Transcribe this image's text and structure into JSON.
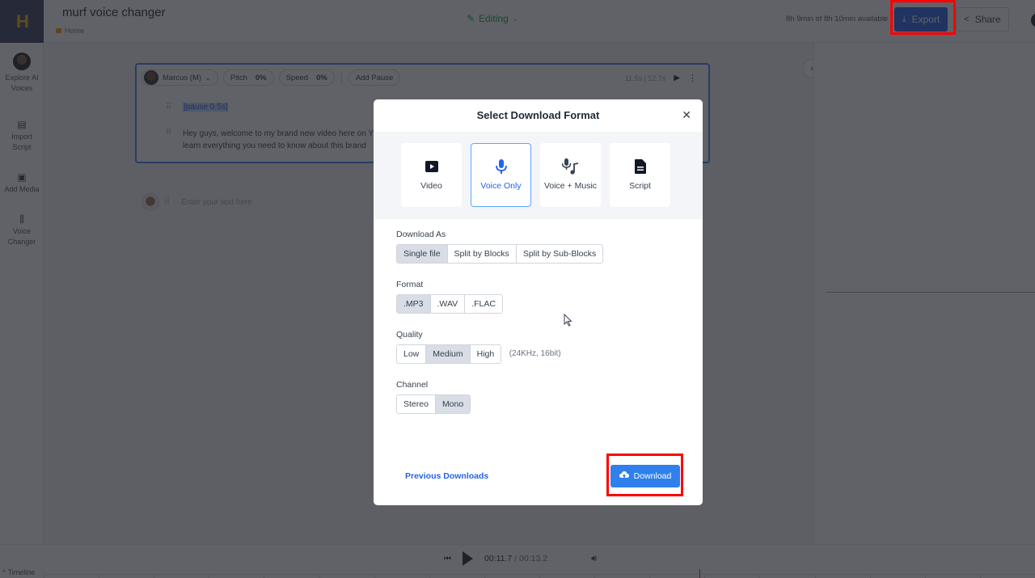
{
  "app": {
    "logo_mark": "H",
    "project_title": "murf voice changer",
    "breadcrumb": "Home",
    "mode": "Editing",
    "quota": "8h 9min of 8h 10min available",
    "export_label": "Export",
    "share_label": "Share"
  },
  "sidebar": {
    "items": [
      {
        "label": "Explore AI Voices",
        "icon": "voice-avatar"
      },
      {
        "label": "Import Script",
        "icon": "import-script-icon"
      },
      {
        "label": "Add Media",
        "icon": "add-media-icon"
      },
      {
        "label": "Voice Changer",
        "icon": "voice-changer-icon"
      }
    ]
  },
  "editor": {
    "block": {
      "speaker": "Marcus (M)",
      "pitch_label": "Pitch",
      "pitch_value": "0%",
      "speed_label": "Speed",
      "speed_value": "0%",
      "add_pause_label": "Add Pause",
      "duration": "11.5s | 12.7s",
      "pause_tag": "[pause 0.5s]",
      "text_line1": "Hey guys, welcome to my brand new video here on Y",
      "text_line2": "learn everything you need to know about this brand"
    },
    "empty_placeholder": "Enter your text here"
  },
  "player": {
    "current_time": "00:11.7",
    "separator": " / ",
    "total_time": "00:13.2",
    "timeline_label": "Timeline",
    "timeline_toggle_icon": "chevron-up-icon"
  },
  "modal": {
    "title": "Select Download Format",
    "close_icon": "close-icon",
    "formats": [
      {
        "label": "Video",
        "icon": "video-icon",
        "selected": false
      },
      {
        "label": "Voice Only",
        "icon": "microphone-icon",
        "selected": true
      },
      {
        "label": "Voice + Music",
        "icon": "voice-music-icon",
        "selected": false
      },
      {
        "label": "Script",
        "icon": "document-icon",
        "selected": false
      }
    ],
    "download_as": {
      "label": "Download As",
      "options": [
        "Single file",
        "Split by Blocks",
        "Split by Sub-Blocks"
      ],
      "selected": "Single file"
    },
    "format": {
      "label": "Format",
      "options": [
        ".MP3",
        ".WAV",
        ".FLAC"
      ],
      "selected": ".MP3"
    },
    "quality": {
      "label": "Quality",
      "options": [
        "Low",
        "Medium",
        "High"
      ],
      "selected": "Medium",
      "note": "(24KHz, 16bit)"
    },
    "channel": {
      "label": "Channel",
      "options": [
        "Stereo",
        "Mono"
      ],
      "selected": "Mono"
    },
    "previous_downloads_label": "Previous Downloads",
    "download_label": "Download"
  },
  "colors": {
    "accent": "#2f80ed",
    "highlight_box": "#ff0000",
    "editing_green": "#16a34a"
  }
}
